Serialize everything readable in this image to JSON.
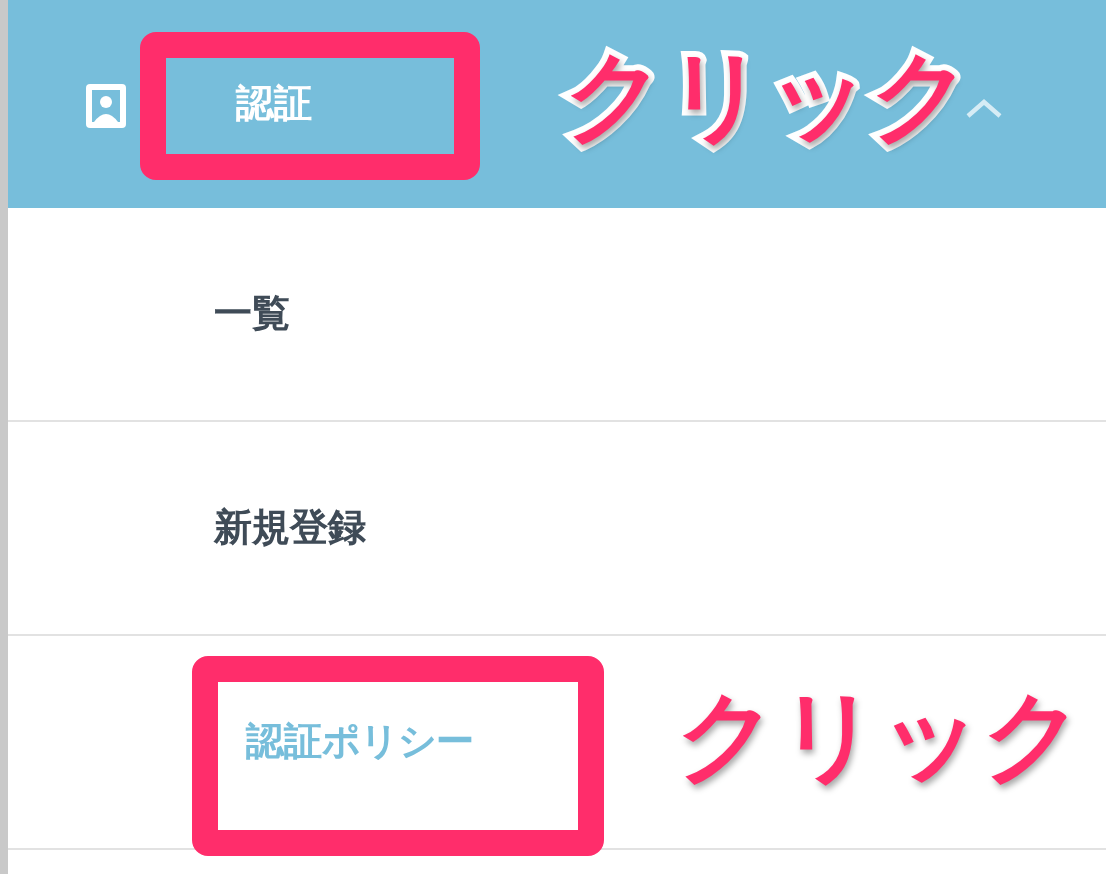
{
  "menu": {
    "label": "認証",
    "expanded": true,
    "items": [
      {
        "label": "一覧",
        "selected": false
      },
      {
        "label": "新規登録",
        "selected": false
      },
      {
        "label": "認証ポリシー",
        "selected": true
      }
    ]
  },
  "annotations": [
    {
      "kind": "box"
    },
    {
      "kind": "callout",
      "text": "クリック"
    },
    {
      "kind": "box"
    },
    {
      "kind": "callout",
      "text": "クリック"
    }
  ]
}
